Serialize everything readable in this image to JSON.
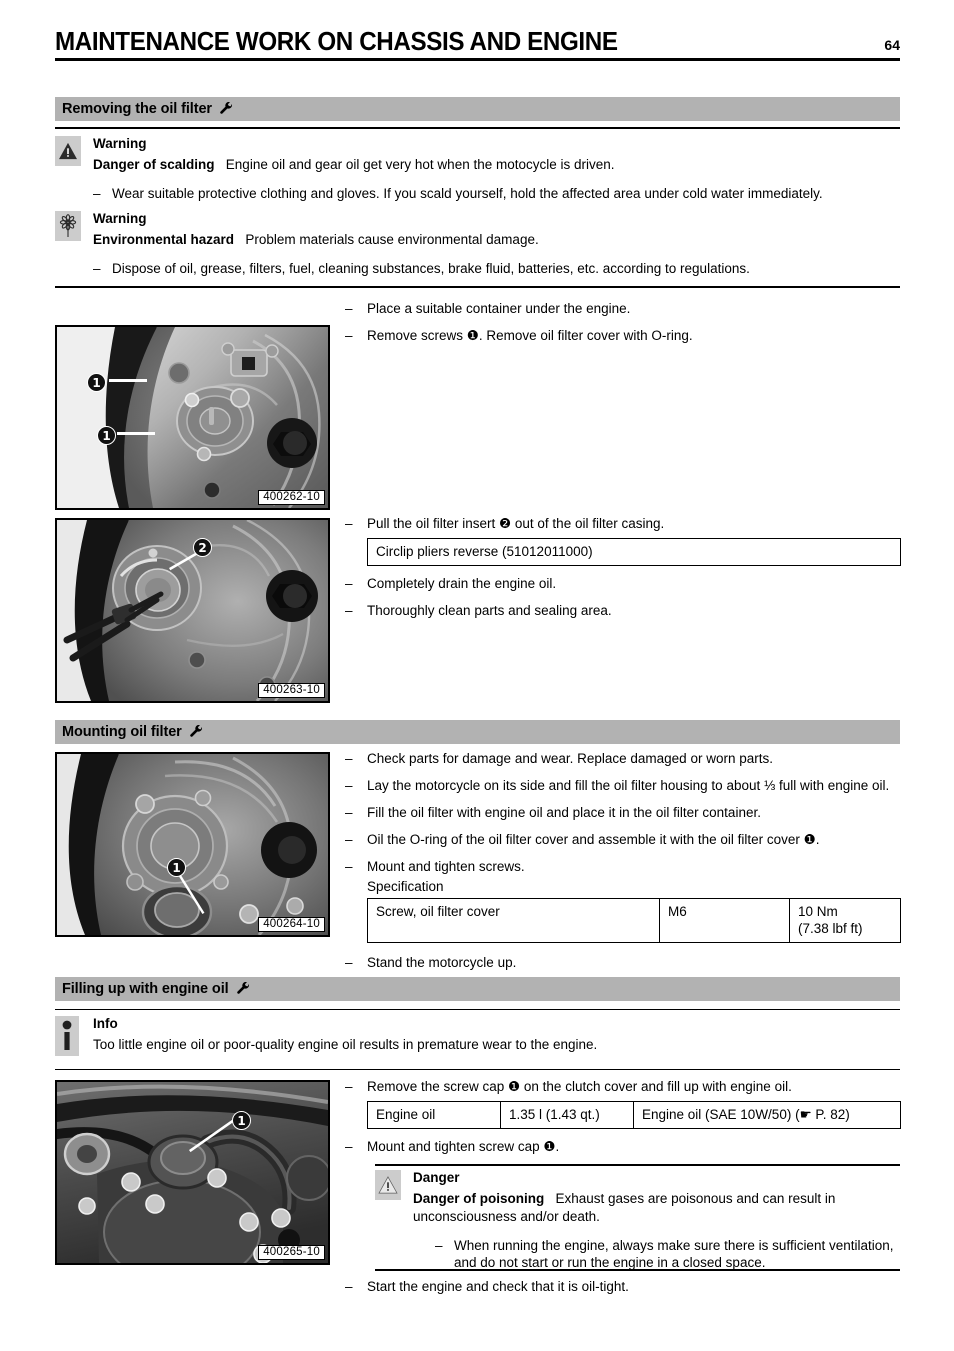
{
  "header": {
    "title": "MAINTENANCE WORK ON CHASSIS AND ENGINE",
    "page_number": "64"
  },
  "sections": {
    "removing": {
      "heading": "Removing the oil filter",
      "icon": "wrench-icon",
      "warning_scalding": {
        "icon": "warning-triangle-icon",
        "kind": "Warning",
        "lead": "Danger of scalding",
        "text": "Engine oil and gear oil get very hot when the motocycle is driven.",
        "bullet": "Wear suitable protective clothing and gloves. If you scald yourself, hold the affected area under cold water immediately."
      },
      "warning_environment": {
        "icon": "environment-flower-icon",
        "kind": "Warning",
        "lead": "Environmental hazard",
        "text": "Problem materials cause environmental damage.",
        "bullet": "Dispose of oil, grease, filters, fuel, cleaning substances, brake fluid, batteries, etc. according to regulations."
      },
      "steps_group_1": [
        "Place a suitable container under the engine.",
        "Remove screws ❶. Remove oil filter cover with O-ring."
      ],
      "steps_group_2_intro": "Pull the oil filter insert ❷ out of the oil filter casing.",
      "tool_box": "Circlip pliers reverse (51012011000)",
      "steps_group_2_rest": [
        "Completely drain the engine oil.",
        "Thoroughly clean parts and sealing area."
      ],
      "photo_1_caption": "400262-10",
      "photo_1_callouts": [
        "1",
        "1"
      ],
      "photo_2_caption": "400263-10",
      "photo_2_callouts": [
        "2"
      ]
    },
    "mounting": {
      "heading": "Mounting oil filter",
      "icon": "wrench-icon",
      "steps": [
        "Check parts for damage and wear. Replace damaged or worn parts.",
        "Lay the motorcycle on its side and fill the oil filter housing to about ⅓ full with engine oil.",
        "Fill the oil filter with engine oil and place it in the oil filter container.",
        "Oil the O-ring of the oil filter cover and assemble it with the oil filter cover ❶.",
        "Mount and tighten screws."
      ],
      "spec_label": "Specification",
      "spec_table": {
        "rows": [
          {
            "item": "Screw, oil filter cover",
            "size": "M6",
            "torque_line1": "10 Nm",
            "torque_line2": "(7.38 lbf ft)"
          }
        ]
      },
      "final_step": "Stand the motorcycle up.",
      "photo_caption": "400264-10",
      "photo_callouts": [
        "1"
      ]
    },
    "filling": {
      "heading": "Filling up with engine oil",
      "icon": "wrench-icon",
      "info": {
        "icon": "info-icon",
        "kind": "Info",
        "text": "Too little engine oil or poor-quality engine oil results in premature wear to the engine."
      },
      "step_remove": "Remove the screw cap ❶ on the clutch cover and fill up with engine oil.",
      "oil_table": {
        "rows": [
          {
            "item": "Engine oil",
            "quantity": "1.35 l (1.43 qt.)",
            "spec": "Engine oil (SAE 10W/50)  (☛ P. 82)"
          }
        ]
      },
      "step_mount": "Mount and tighten screw cap ❶.",
      "danger": {
        "icon": "danger-triangle-icon",
        "kind": "Danger",
        "lead": "Danger of poisoning",
        "text": "Exhaust gases are poisonous and can result in unconsciousness and/or death.",
        "bullet": "When running the engine, always make sure there is sufficient ventilation, and do not start or run the engine in a closed space."
      },
      "step_start": "Start the engine and check that it is oil-tight.",
      "photo_caption": "400265-10",
      "photo_callouts": [
        "1"
      ]
    }
  },
  "colors": {
    "section_bar": "#b2b2b2",
    "notice_icon_bg": "#cccccc",
    "rule": "#000000"
  }
}
